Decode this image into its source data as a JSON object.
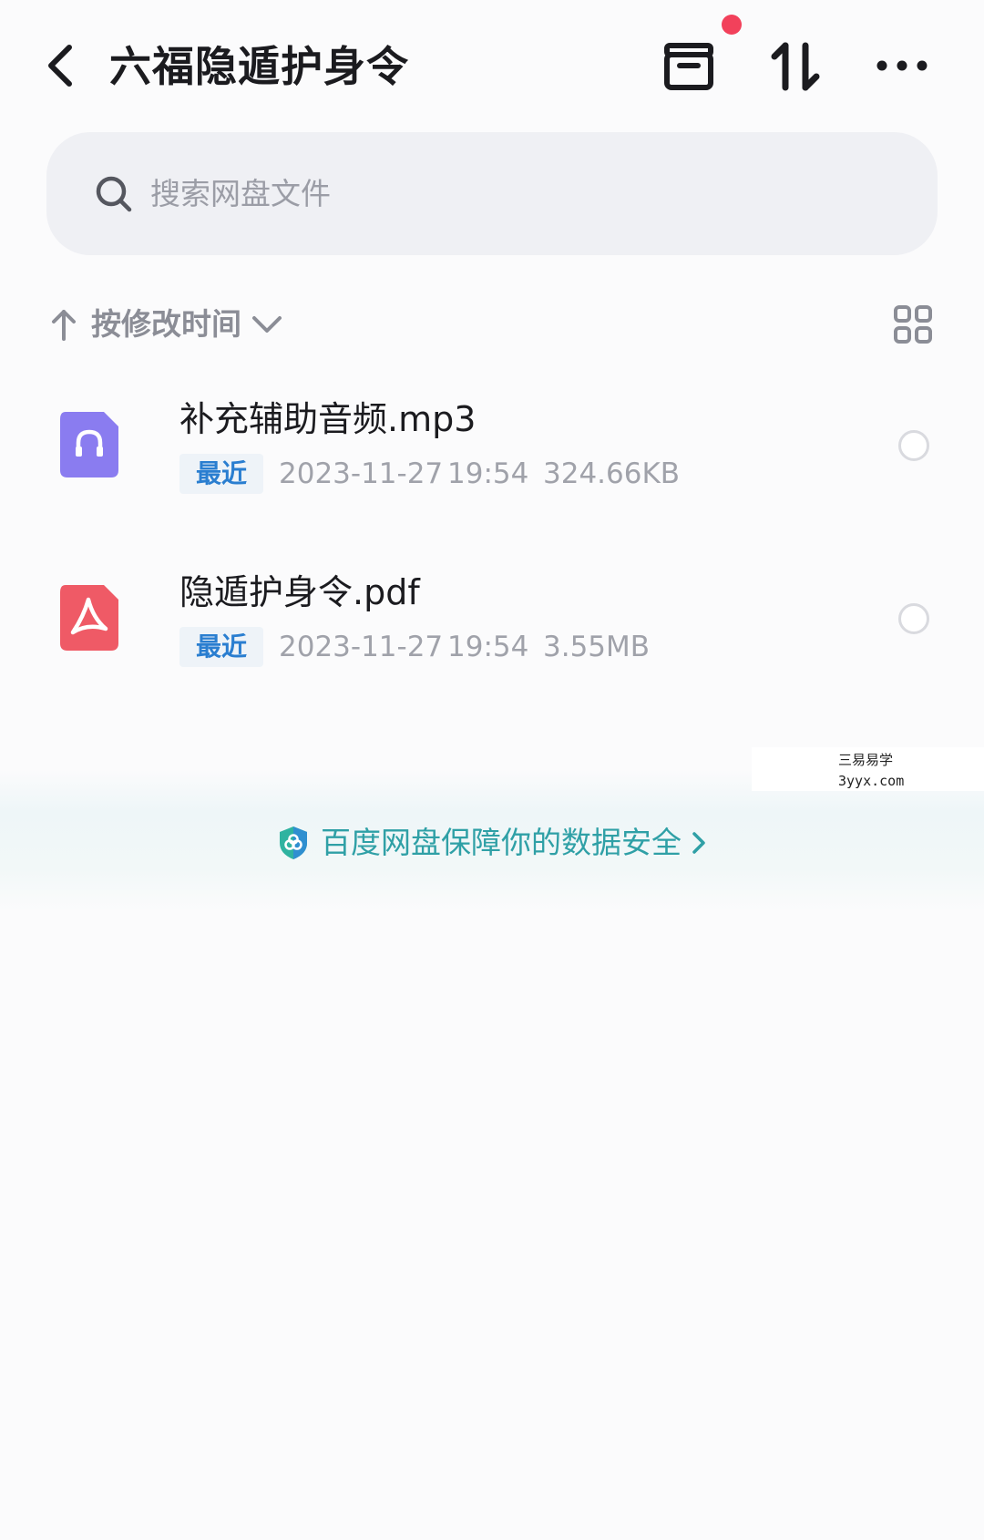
{
  "header": {
    "title": "六福隐遁护身令",
    "icons": [
      "back-arrow-icon",
      "box-icon",
      "sort-transfer-icon",
      "more-icon"
    ],
    "notification_dot_color": "#f2415b"
  },
  "search": {
    "placeholder": "搜索网盘文件",
    "icon": "search-icon"
  },
  "sort": {
    "label": "按修改时间",
    "direction_icon": "arrow-up-icon",
    "dropdown_icon": "chevron-down-icon",
    "view_toggle_icon": "grid-view-icon"
  },
  "files": [
    {
      "name": "补充辅助音频.mp3",
      "badge": "最近",
      "date": "2023-11-27",
      "time": "19:54",
      "size": "324.66KB",
      "icon": "audio-file-icon",
      "icon_color": "#8a7cf0",
      "selected": false
    },
    {
      "name": "隐遁护身令.pdf",
      "badge": "最近",
      "date": "2023-11-27",
      "time": "19:54",
      "size": "3.55MB",
      "icon": "pdf-file-icon",
      "icon_color": "#ef5a66",
      "selected": false
    }
  ],
  "watermark": {
    "line1": "三易易学",
    "line2": "3yyx.com"
  },
  "banner": {
    "text": "百度网盘保障你的数据安全",
    "icon": "shield-icon",
    "accent_color": "#2fa0a6"
  }
}
